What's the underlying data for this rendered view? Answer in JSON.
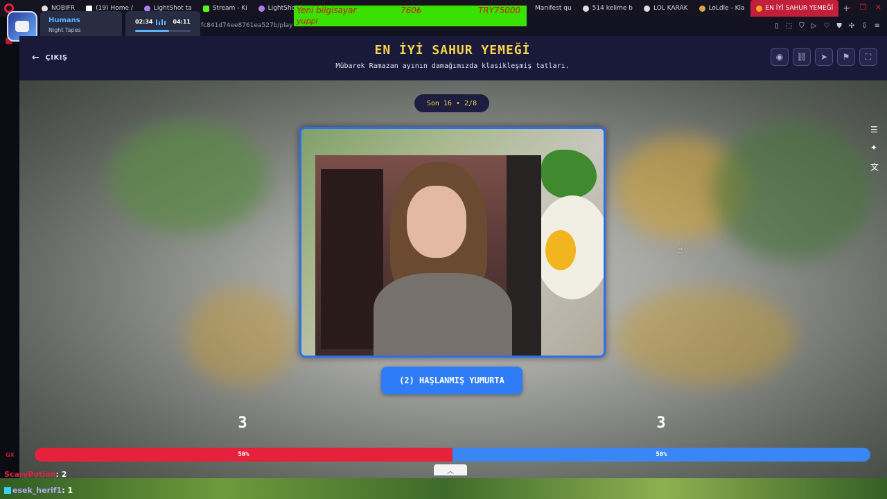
{
  "browser": {
    "tabs": [
      {
        "label": "NOBIFR"
      },
      {
        "label": "(19) Home /"
      },
      {
        "label": "LightShot ta"
      },
      {
        "label": "Stream - Ki"
      },
      {
        "label": "LightShot t"
      },
      {
        "label": "Manifest qu"
      },
      {
        "label": "514 kelime b"
      },
      {
        "label": "LOL KARAK"
      },
      {
        "label": "LoLdle - Kla"
      },
      {
        "label": "EN İYİ SAHUR YEMEĞİ"
      }
    ],
    "new_tab": "+",
    "url": "fc841d74ee8761ea527b/play"
  },
  "music": {
    "title": "Humans",
    "artist": "Night Tapes",
    "current_time": "02:34",
    "total_time": "04:11",
    "progress": 0.61
  },
  "banner": {
    "line1_a": "Yeni bilgisayar",
    "line1_b": "760₺",
    "line1_c": "TRY75000",
    "line2": "yuppi"
  },
  "header": {
    "exit_label": "ÇIKIŞ",
    "title": "EN İYİ SAHUR YEMEĞİ",
    "subtitle": "Mübarek Ramazan ayının damağımızda klasikleşmiş tatları."
  },
  "game": {
    "round_label": "Son 16 • 2/8",
    "choice_label": "(2) HAŞLANMIŞ YUMURTA",
    "score_left": "3",
    "score_right": "3",
    "vote_left_percent": "50%",
    "vote_right_percent": "50%",
    "vote_left_fraction": 0.5
  },
  "chat": [
    {
      "user": "ScaryPotion",
      "message": ": 2"
    },
    {
      "user": "esek_herif1",
      "message": ": 1"
    }
  ],
  "colors": {
    "accent_yellow": "#f5d34a",
    "red": "#e5213c",
    "blue": "#3a86f5",
    "header_bg": "#191a3a"
  }
}
